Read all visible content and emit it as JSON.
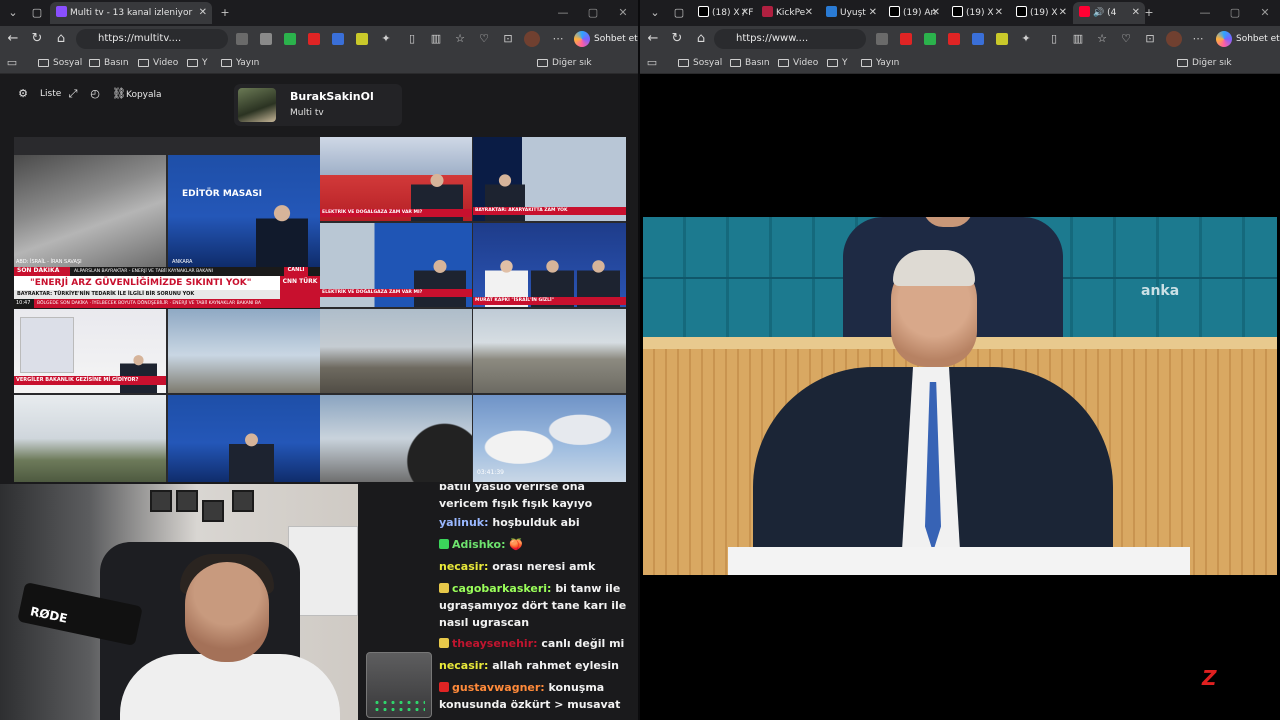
{
  "left_window": {
    "tab": {
      "title": "Multi tv - 13 kanal izleniyor"
    },
    "url": "https://multitv....",
    "copilot_label": "Sohbet et",
    "bookmarks": [
      "Sosyal",
      "Basın",
      "Video",
      "Y",
      "Yayın"
    ],
    "other_favorites": "Diğer sık kullanılanlar",
    "controls": {
      "list_label": "Liste",
      "copy_label": "Kopyala"
    },
    "channel": {
      "name": "BurakSakinOl",
      "subtitle": "Multi tv"
    },
    "tiles": {
      "t1_caption": "ABD: İSRAİL - İRAN SAVAŞI",
      "t2_brand": "EDİTÖR MASASI",
      "t2_city": "ANKARA",
      "breaking_label": "SON DAKİKA",
      "breaking_sub": "ALPARSLAN BAYRAKTAR - ENERJİ VE TABİİ KAYNAKLAR BAKANI",
      "breaking_headline": "\"ENERJİ ARZ GÜVENLİĞİMİZDE SIKINTI YOK\"",
      "breaking_line2": "BAYRAKTAR: TÜRKİYE'NİN TEDARİK İLE İLGİLİ BİR SORUNU YOK",
      "breaking_time": "10:47",
      "breaking_ticker": "BÖLGEDE SON DAKİKA · İYELBECEK BOYUTA DÖNÜŞEBİLİR · ENERJİ VE TABİİ KAYNAKLAR BAKANI BA",
      "live_label": "CANLI",
      "cnn_label": "CNN TÜRK",
      "t3_caption": "ELEKTRİK VE DOĞALGAZA ZAM VAR MI?",
      "t4_caption": "BAYRAKTAR: AKARYAKITTA ZAM YOK",
      "t6_caption": "ELEKTRİK VE DOĞALGAZA ZAM VAR MI?",
      "t7_caption": "MURAT KAPKI \"İSRAİL'İN GİZLİ\"",
      "t8_caption": "VERGİLER BAKANLIK GEZİSİNE Mİ GİDİYOR?",
      "t_clock": "03:41:39"
    },
    "chat": [
      {
        "user": "",
        "color": "#ffffff",
        "text": "batılı yasuo verirse ona vericem fışık fışık kayıyo"
      },
      {
        "user": "yalinuk:",
        "color": "#9ab8ff",
        "text": "hoşbulduk abi"
      },
      {
        "user": "Adishko:",
        "color": "#6ee36e",
        "text": "🍑"
      },
      {
        "user": "necasir:",
        "color": "#e8e83a",
        "text": "orası neresi amk"
      },
      {
        "user": "cagobarkaskeri:",
        "color": "#9aff5a",
        "text": "bi tanw ile ugraşamıyoz dört tane karı ile nasıl ugrascan"
      },
      {
        "user": "theaysenehir:",
        "color": "#c0152f",
        "text": "canlı değil mi"
      },
      {
        "user": "necasir:",
        "color": "#e8e83a",
        "text": "allah rahmet eylesin"
      },
      {
        "user": "gustavwagner:",
        "color": "#ff8a3a",
        "text": "konuşma konusunda özkürt > musavat"
      }
    ],
    "webcam_mic_brand": "RØDE"
  },
  "right_window": {
    "tabs": [
      "(18) X / F",
      "KickPe",
      "Uyuşt",
      "(19) An",
      "(19) X",
      "(19) X",
      "(4"
    ],
    "url": "https://www....",
    "copilot_label": "Sohbet et",
    "bookmarks": [
      "Sosyal",
      "Basın",
      "Video",
      "Y",
      "Yayın"
    ],
    "other_favorites": "Diğer sık kullanılanlar",
    "video_watermark": "anka",
    "corner_logo": "Z"
  },
  "colors": {
    "tab_bg": "#1c1c1f",
    "toolbar_bg": "#38393c",
    "chat_bg": "#1a1a1c",
    "breaking_red": "#c8102e"
  }
}
